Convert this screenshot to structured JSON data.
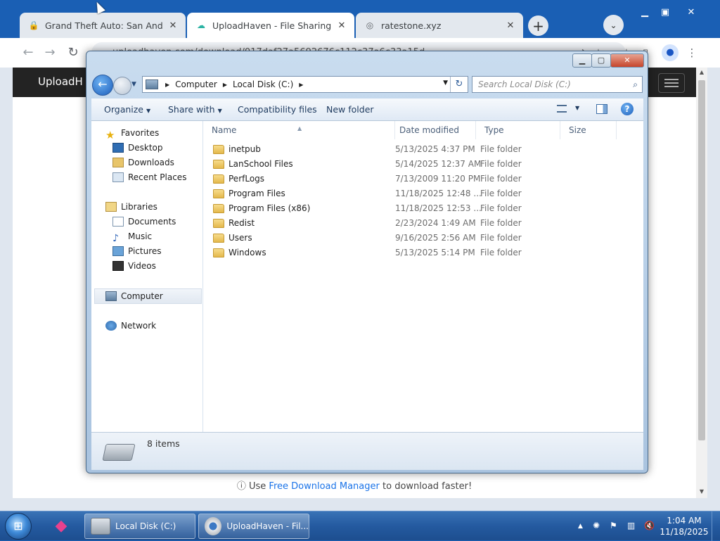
{
  "browser": {
    "tabs": [
      {
        "title": "Grand Theft Auto: San Andreas |",
        "favicon": "lock-icon",
        "active": false
      },
      {
        "title": "UploadHaven - File Sharing Mad",
        "favicon": "uploadhaven-icon",
        "active": true
      },
      {
        "title": "ratestone.xyz",
        "favicon": "globe-icon",
        "active": false
      }
    ],
    "new_tab": "+",
    "tab_search": "⌄",
    "url": "uploadhaven.com/download/017daf27a5692676c112c37a6c33a15d",
    "site_logo": "UploadH",
    "footer_prefix": "ⓘ Use ",
    "footer_link": "Free Download Manager",
    "footer_suffix": " to download faster!"
  },
  "explorer": {
    "breadcrumb": [
      "Computer",
      "Local Disk (C:)"
    ],
    "search_placeholder": "Search Local Disk (C:)",
    "commands": {
      "organize": "Organize",
      "share_with": "Share with",
      "compatibility": "Compatibility files",
      "new_folder": "New folder"
    },
    "nav": {
      "favorites": "Favorites",
      "desktop": "Desktop",
      "downloads": "Downloads",
      "recent": "Recent Places",
      "libraries": "Libraries",
      "documents": "Documents",
      "music": "Music",
      "pictures": "Pictures",
      "videos": "Videos",
      "computer": "Computer",
      "network": "Network"
    },
    "columns": {
      "name": "Name",
      "date": "Date modified",
      "type": "Type",
      "size": "Size"
    },
    "files": [
      {
        "name": "inetpub",
        "date": "5/13/2025 4:37 PM",
        "type": "File folder"
      },
      {
        "name": "LanSchool Files",
        "date": "5/14/2025 12:37 AM",
        "type": "File folder"
      },
      {
        "name": "PerfLogs",
        "date": "7/13/2009 11:20 PM",
        "type": "File folder"
      },
      {
        "name": "Program Files",
        "date": "11/18/2025 12:48 ...",
        "type": "File folder"
      },
      {
        "name": "Program Files (x86)",
        "date": "11/18/2025 12:53 ...",
        "type": "File folder"
      },
      {
        "name": "Redist",
        "date": "2/23/2024 1:49 AM",
        "type": "File folder"
      },
      {
        "name": "Users",
        "date": "9/16/2025 2:56 AM",
        "type": "File folder"
      },
      {
        "name": "Windows",
        "date": "5/13/2025 5:14 PM",
        "type": "File folder"
      }
    ],
    "item_count": "8 items"
  },
  "taskbar": {
    "buttons": [
      {
        "label": "Local Disk (C:)"
      },
      {
        "label": "UploadHaven - Fil..."
      }
    ],
    "time": "1:04 AM",
    "date": "11/18/2025"
  }
}
